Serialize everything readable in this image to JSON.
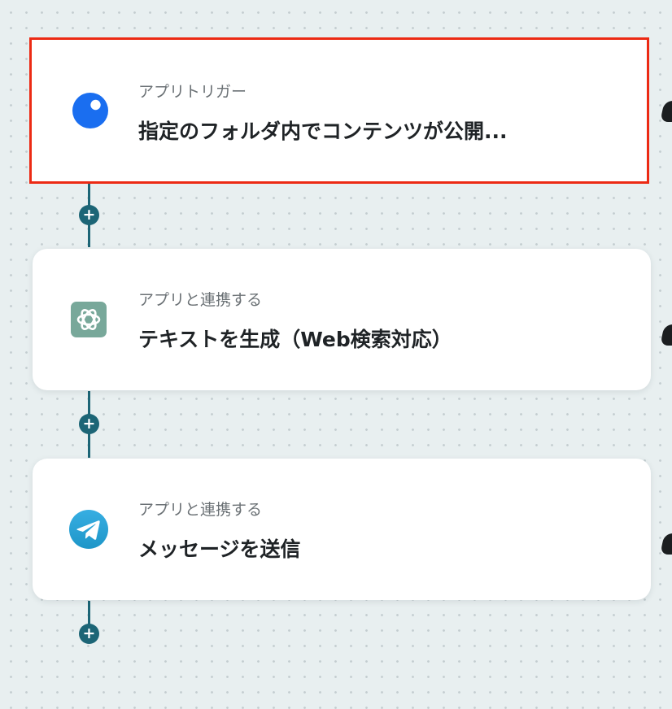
{
  "flow": {
    "steps": [
      {
        "subtitle": "アプリトリガー",
        "title": "指定のフォルダ内でコンテンツが公開...",
        "icon": "blue-dot-app-icon",
        "selected": true
      },
      {
        "subtitle": "アプリと連携する",
        "title": "テキストを生成（Web検索対応）",
        "icon": "chatgpt-icon",
        "selected": false
      },
      {
        "subtitle": "アプリと連携する",
        "title": "メッセージを送信",
        "icon": "telegram-icon",
        "selected": false
      }
    ],
    "add_button_glyph": "+"
  },
  "colors": {
    "canvas_bg": "#e8eff0",
    "connector": "#1c6576",
    "selected_border": "#ec2a14",
    "trigger_blue": "#1a6ef0",
    "chatgpt_green": "#78a89a",
    "telegram_blue": "#2aa1dc"
  }
}
